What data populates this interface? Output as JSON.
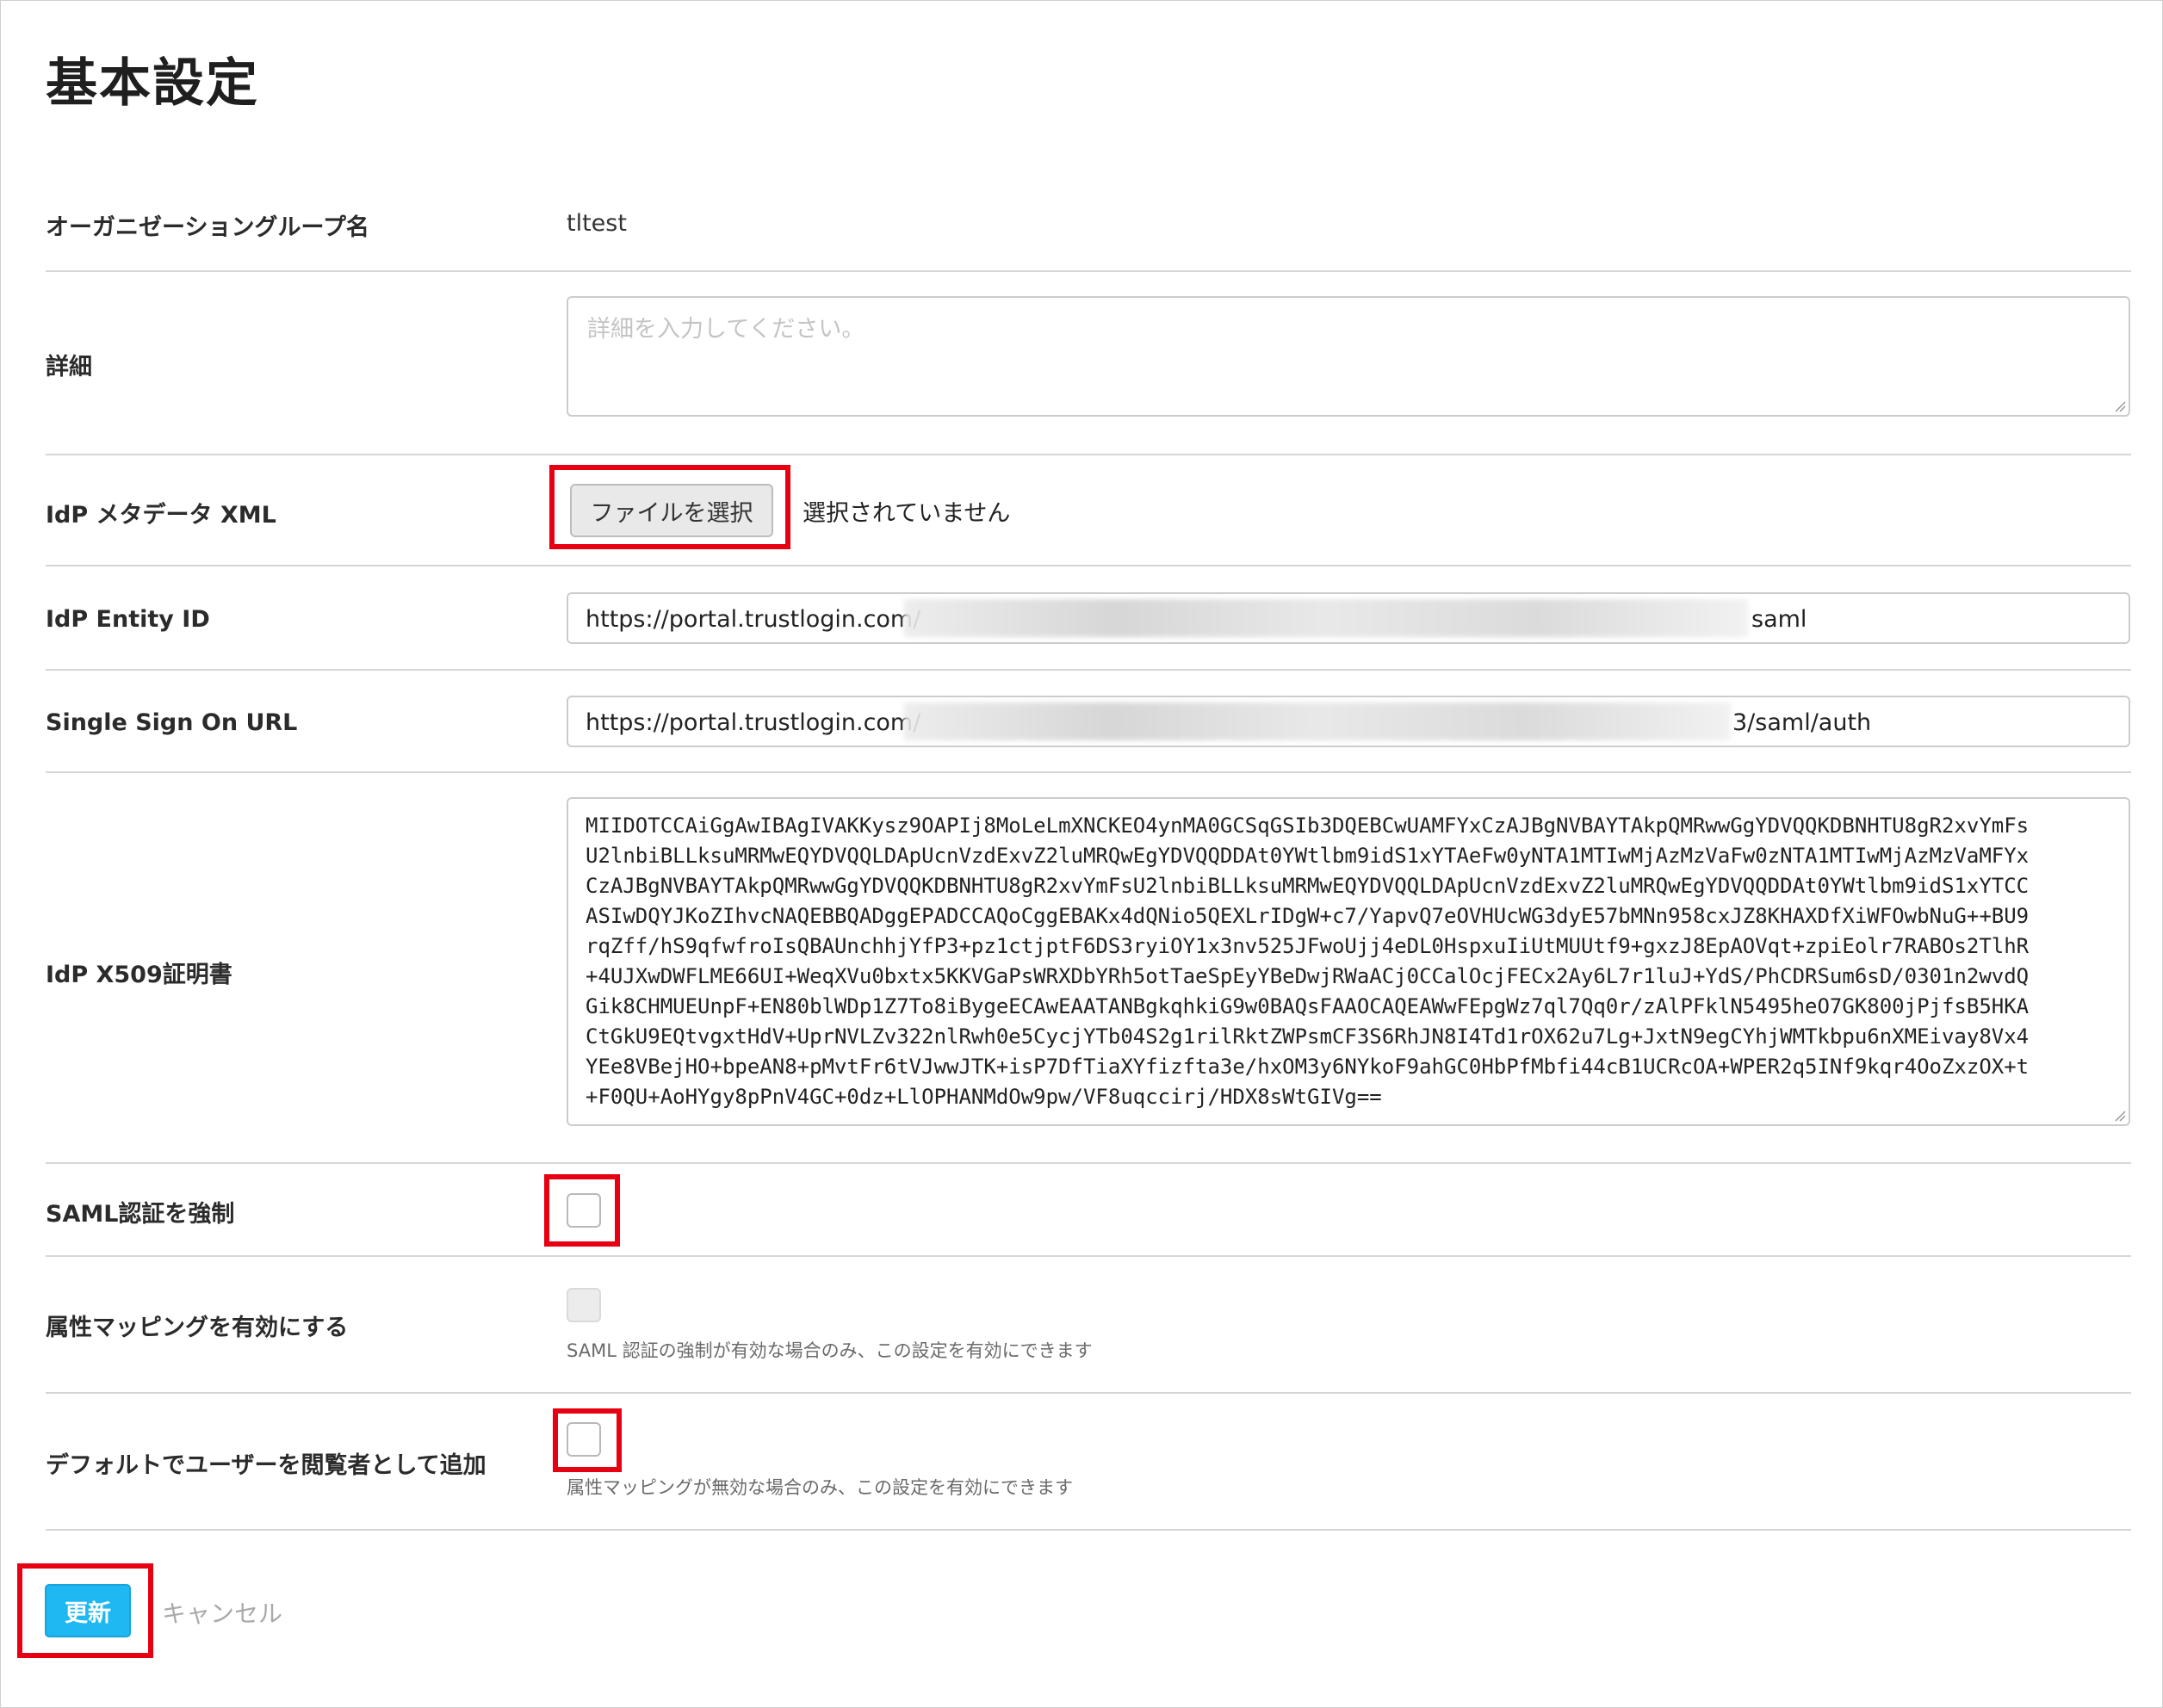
{
  "page": {
    "title": "基本設定"
  },
  "form": {
    "org_group": {
      "label": "オーガニゼーショングループ名",
      "value": "tltest"
    },
    "details": {
      "label": "詳細",
      "placeholder": "詳細を入力してください。"
    },
    "idp_metadata": {
      "label": "IdP メタデータ XML",
      "button": "ファイルを選択",
      "status": "選択されていません"
    },
    "idp_entity_id": {
      "label": "IdP Entity ID",
      "value_prefix": "https://portal.trustlogin.com/",
      "value_suffix": "saml"
    },
    "sso_url": {
      "label": "Single Sign On URL",
      "value_prefix": "https://portal.trustlogin.com/",
      "value_suffix": "3/saml/auth"
    },
    "x509": {
      "label": "IdP X509証明書",
      "value": "MIIDOTCCAiGgAwIBAgIVAKKysz9OAPIj8MoLeLmXNCKEO4ynMA0GCSqGSIb3DQEBCwUAMFYxCzAJBgNVBAYTAkpQMRwwGgYDVQQKDBNHTU8gR2xvYmFs\nU2lnbiBLLksuMRMwEQYDVQQLDApUcnVzdExvZ2luMRQwEgYDVQQDDAt0YWtlbm9idS1xYTAeFw0yNTA1MTIwMjAzMzVaFw0zNTA1MTIwMjAzMzVaMFYx\nCzAJBgNVBAYTAkpQMRwwGgYDVQQKDBNHTU8gR2xvYmFsU2lnbiBLLksuMRMwEQYDVQQLDApUcnVzdExvZ2luMRQwEgYDVQQDDAt0YWtlbm9idS1xYTCC\nASIwDQYJKoZIhvcNAQEBBQADggEPADCCAQoCggEBAKx4dQNio5QEXLrIDgW+c7/YapvQ7eOVHUcWG3dyE57bMNn958cxJZ8KHAXDfXiWFOwbNuG++BU9\nrqZff/hS9qfwfroIsQBAUnchhjYfP3+pz1ctjptF6DS3ryiOY1x3nv525JFwoUjj4eDL0HspxuIiUtMUUtf9+gxzJ8EpAOVqt+zpiEolr7RABOs2TlhR\n+4UJXwDWFLME66UI+WeqXVu0bxtx5KKVGaPsWRXDbYRh5otTaeSpEyYBeDwjRWaACj0CCalOcjFECx2Ay6L7r1luJ+YdS/PhCDRSum6sD/0301n2wvdQ\nGik8CHMUEUnpF+EN80blWDp1Z7To8iBygeECAwEAATANBgkqhkiG9w0BAQsFAAOCAQEAWwFEpgWz7ql7Qq0r/zAlPFklN5495heO7GK800jPjfsB5HKA\nCtGkU9EQtvgxtHdV+UprNVLZv322nlRwh0e5CycjYTb04S2g1rilRktZWPsmCF3S6RhJN8I4Td1rOX62u7Lg+JxtN9egCYhjWMTkbpu6nXMEivay8Vx4\nYEe8VBejHO+bpeAN8+pMvtFr6tVJwwJTK+isP7DfTiaXYfizfta3e/hxOM3y6NYkoF9ahGC0HbPfMbfi44cB1UCRcOA+WPER2q5INf9kqr4OoZxzOX+t\n+F0QU+AoHYgy8pPnV4GC+0dz+LlOPHANMdOw9pw/VF8uqccirj/HDX8sWtGIVg=="
    },
    "saml_enforce": {
      "label": "SAML認証を強制"
    },
    "attr_mapping": {
      "label": "属性マッピングを有効にする",
      "help": "SAML 認証の強制が有効な場合のみ、この設定を有効にできます"
    },
    "default_viewer": {
      "label": "デフォルトでユーザーを閲覧者として追加",
      "help": "属性マッピングが無効な場合のみ、この設定を有効にできます"
    }
  },
  "actions": {
    "update": "更新",
    "cancel": "キャンセル"
  },
  "colors": {
    "accent": "#1fb8f2",
    "highlight": "#e60012"
  }
}
